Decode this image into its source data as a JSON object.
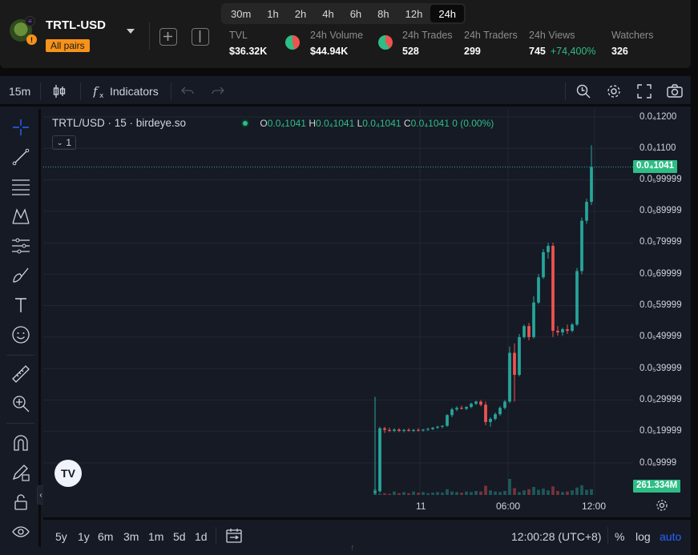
{
  "header": {
    "pair_name": "TRTL-USD",
    "pair_badge": "All pairs",
    "timeframes": [
      "30m",
      "1h",
      "2h",
      "4h",
      "6h",
      "8h",
      "12h",
      "24h"
    ],
    "active_timeframe": "24h",
    "stats": {
      "tvl": {
        "label": "TVL",
        "value": "$36.32K"
      },
      "volume": {
        "label": "24h Volume",
        "value": "$44.94K"
      },
      "trades": {
        "label": "24h Trades",
        "value": "528"
      },
      "traders": {
        "label": "24h Traders",
        "value": "299"
      },
      "views": {
        "label": "24h Views",
        "value": "745",
        "change": "+74,400%"
      },
      "watchers": {
        "label": "Watchers",
        "value": "326"
      }
    }
  },
  "toolbar": {
    "interval": "15m",
    "indicators_label": "Indicators"
  },
  "legend": {
    "symbol": "TRTL/USD · 15 · birdeye.so",
    "o_label": "O",
    "o_value": "0.0₄1041",
    "h_label": "H",
    "h_value": "0.0₄1041",
    "l_label": "L",
    "l_value": "0.0₄1041",
    "c_label": "C",
    "c_value": "0.0₄1041",
    "change": "0 (0.00%)",
    "collapse_count": "1"
  },
  "price_axis": {
    "ticks": [
      "0.0₄1200",
      "0.0₄1100",
      "0.0₅99999",
      "0.0₅89999",
      "0.0₅79999",
      "0.0₅69999",
      "0.0₅59999",
      "0.0₅49999",
      "0.0₅39999",
      "0.0₅29999",
      "0.0₅19999",
      "0.0₆9999"
    ],
    "current_price_label": "0.0₄1041",
    "volume_label": "261.334M"
  },
  "time_axis": {
    "ticks": [
      "11",
      "06:00",
      "12:00"
    ]
  },
  "bottom": {
    "ranges": [
      "5y",
      "1y",
      "6m",
      "3m",
      "1m",
      "5d",
      "1d"
    ],
    "clock": "12:00:28 (UTC+8)",
    "percent_label": "%",
    "log_label": "log",
    "auto_label": "auto"
  },
  "colors": {
    "up": "#26a69a",
    "down": "#ef5350",
    "accent": "#2962ff",
    "badge": "#f7931a"
  },
  "chart_data": {
    "type": "candlestick",
    "interval": "15m",
    "y_unit": "USD (×1e-5)",
    "candles": [
      {
        "o": 0.05,
        "h": 3.1,
        "l": 0.0,
        "c": 0.1
      },
      {
        "o": 0.1,
        "h": 2.15,
        "l": 0.05,
        "c": 2.1
      },
      {
        "o": 2.1,
        "h": 2.15,
        "l": 1.95,
        "c": 2.05
      },
      {
        "o": 2.05,
        "h": 2.12,
        "l": 1.98,
        "c": 2.02
      },
      {
        "o": 2.02,
        "h": 2.1,
        "l": 1.98,
        "c": 2.06
      },
      {
        "o": 2.06,
        "h": 2.1,
        "l": 1.98,
        "c": 2.02
      },
      {
        "o": 2.02,
        "h": 2.08,
        "l": 1.97,
        "c": 2.05
      },
      {
        "o": 2.05,
        "h": 2.1,
        "l": 2.0,
        "c": 2.02
      },
      {
        "o": 2.02,
        "h": 2.08,
        "l": 1.98,
        "c": 2.05
      },
      {
        "o": 2.05,
        "h": 2.1,
        "l": 2.0,
        "c": 2.03
      },
      {
        "o": 2.03,
        "h": 2.08,
        "l": 2.0,
        "c": 2.06
      },
      {
        "o": 2.06,
        "h": 2.12,
        "l": 2.02,
        "c": 2.08
      },
      {
        "o": 2.08,
        "h": 2.14,
        "l": 2.04,
        "c": 2.12
      },
      {
        "o": 2.12,
        "h": 2.18,
        "l": 2.08,
        "c": 2.15
      },
      {
        "o": 2.15,
        "h": 2.2,
        "l": 2.1,
        "c": 2.18
      },
      {
        "o": 2.18,
        "h": 2.55,
        "l": 2.15,
        "c": 2.52
      },
      {
        "o": 2.52,
        "h": 2.75,
        "l": 2.45,
        "c": 2.7
      },
      {
        "o": 2.7,
        "h": 2.8,
        "l": 2.65,
        "c": 2.75
      },
      {
        "o": 2.75,
        "h": 2.82,
        "l": 2.7,
        "c": 2.72
      },
      {
        "o": 2.72,
        "h": 2.8,
        "l": 2.68,
        "c": 2.78
      },
      {
        "o": 2.78,
        "h": 2.92,
        "l": 2.74,
        "c": 2.88
      },
      {
        "o": 2.88,
        "h": 2.98,
        "l": 2.84,
        "c": 2.95
      },
      {
        "o": 2.95,
        "h": 3.0,
        "l": 2.8,
        "c": 2.85
      },
      {
        "o": 2.85,
        "h": 2.95,
        "l": 2.2,
        "c": 2.3
      },
      {
        "o": 2.3,
        "h": 2.45,
        "l": 2.15,
        "c": 2.4
      },
      {
        "o": 2.4,
        "h": 2.6,
        "l": 2.35,
        "c": 2.55
      },
      {
        "o": 2.55,
        "h": 2.8,
        "l": 2.5,
        "c": 2.75
      },
      {
        "o": 2.75,
        "h": 3.0,
        "l": 2.7,
        "c": 2.95
      },
      {
        "o": 2.95,
        "h": 4.7,
        "l": 2.9,
        "c": 4.5
      },
      {
        "o": 4.5,
        "h": 4.8,
        "l": 2.95,
        "c": 3.8
      },
      {
        "o": 3.8,
        "h": 5.1,
        "l": 3.75,
        "c": 5.0
      },
      {
        "o": 5.0,
        "h": 5.4,
        "l": 4.95,
        "c": 5.35
      },
      {
        "o": 5.35,
        "h": 5.45,
        "l": 4.9,
        "c": 5.0
      },
      {
        "o": 5.0,
        "h": 6.3,
        "l": 4.95,
        "c": 6.1
      },
      {
        "o": 6.1,
        "h": 7.0,
        "l": 6.05,
        "c": 6.9
      },
      {
        "o": 6.9,
        "h": 7.8,
        "l": 6.85,
        "c": 7.7
      },
      {
        "o": 7.7,
        "h": 8.0,
        "l": 7.5,
        "c": 7.9
      },
      {
        "o": 7.9,
        "h": 8.0,
        "l": 5.0,
        "c": 5.2
      },
      {
        "o": 5.2,
        "h": 5.35,
        "l": 5.05,
        "c": 5.15
      },
      {
        "o": 5.15,
        "h": 5.3,
        "l": 5.05,
        "c": 5.25
      },
      {
        "o": 5.25,
        "h": 5.4,
        "l": 5.1,
        "c": 5.2
      },
      {
        "o": 5.2,
        "h": 5.45,
        "l": 5.15,
        "c": 5.4
      },
      {
        "o": 5.4,
        "h": 7.2,
        "l": 5.35,
        "c": 7.1
      },
      {
        "o": 7.1,
        "h": 8.8,
        "l": 7.0,
        "c": 8.7
      },
      {
        "o": 8.7,
        "h": 9.4,
        "l": 8.6,
        "c": 9.3
      },
      {
        "o": 9.3,
        "h": 11.1,
        "l": 9.2,
        "c": 10.41
      }
    ],
    "volume": [
      10,
      2,
      3,
      2,
      6,
      3,
      5,
      3,
      6,
      4,
      5,
      3,
      4,
      5,
      4,
      10,
      6,
      5,
      4,
      6,
      5,
      7,
      6,
      16,
      8,
      6,
      5,
      7,
      28,
      12,
      5,
      8,
      10,
      14,
      9,
      11,
      8,
      15,
      7,
      5,
      6,
      8,
      13,
      17,
      9,
      10
    ],
    "last_price": 10.41,
    "ylim": [
      0,
      12.5
    ]
  }
}
